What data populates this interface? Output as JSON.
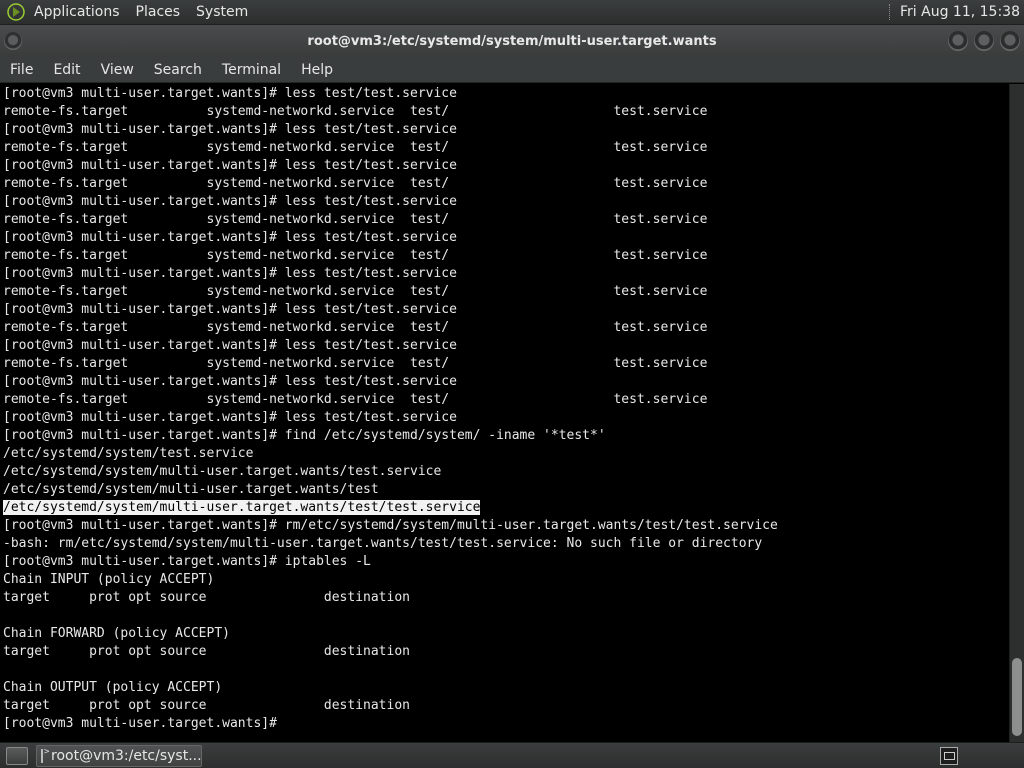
{
  "top_panel": {
    "menus": [
      "Applications",
      "Places",
      "System"
    ],
    "clock": "Fri Aug 11, 15:38"
  },
  "window": {
    "title": "root@vm3:/etc/systemd/system/multi-user.target.wants"
  },
  "menubar": {
    "items": [
      "File",
      "Edit",
      "View",
      "Search",
      "Terminal",
      "Help"
    ]
  },
  "terminal": {
    "lines": [
      "[root@vm3 multi-user.target.wants]# less test/test.service",
      "remote-fs.target          systemd-networkd.service  test/                     test.service",
      "[root@vm3 multi-user.target.wants]# less test/test.service",
      "remote-fs.target          systemd-networkd.service  test/                     test.service",
      "[root@vm3 multi-user.target.wants]# less test/test.service",
      "remote-fs.target          systemd-networkd.service  test/                     test.service",
      "[root@vm3 multi-user.target.wants]# less test/test.service",
      "remote-fs.target          systemd-networkd.service  test/                     test.service",
      "[root@vm3 multi-user.target.wants]# less test/test.service",
      "remote-fs.target          systemd-networkd.service  test/                     test.service",
      "[root@vm3 multi-user.target.wants]# less test/test.service",
      "remote-fs.target          systemd-networkd.service  test/                     test.service",
      "[root@vm3 multi-user.target.wants]# less test/test.service",
      "remote-fs.target          systemd-networkd.service  test/                     test.service",
      "[root@vm3 multi-user.target.wants]# less test/test.service",
      "remote-fs.target          systemd-networkd.service  test/                     test.service",
      "[root@vm3 multi-user.target.wants]# less test/test.service",
      "remote-fs.target          systemd-networkd.service  test/                     test.service",
      "[root@vm3 multi-user.target.wants]# less test/test.service",
      "[root@vm3 multi-user.target.wants]# find /etc/systemd/system/ -iname '*test*'",
      "/etc/systemd/system/test.service",
      "/etc/systemd/system/multi-user.target.wants/test.service",
      "/etc/systemd/system/multi-user.target.wants/test",
      "/etc/systemd/system/multi-user.target.wants/test/test.service",
      "[root@vm3 multi-user.target.wants]# rm/etc/systemd/system/multi-user.target.wants/test/test.service",
      "-bash: rm/etc/systemd/system/multi-user.target.wants/test/test.service: No such file or directory",
      "[root@vm3 multi-user.target.wants]# iptables -L",
      "Chain INPUT (policy ACCEPT)",
      "target     prot opt source               destination",
      "",
      "Chain FORWARD (policy ACCEPT)",
      "target     prot opt source               destination",
      "",
      "Chain OUTPUT (policy ACCEPT)",
      "target     prot opt source               destination",
      "[root@vm3 multi-user.target.wants]# "
    ],
    "highlighted_line_index": 23
  },
  "taskbar": {
    "task_label": "root@vm3:/etc/syst..."
  }
}
